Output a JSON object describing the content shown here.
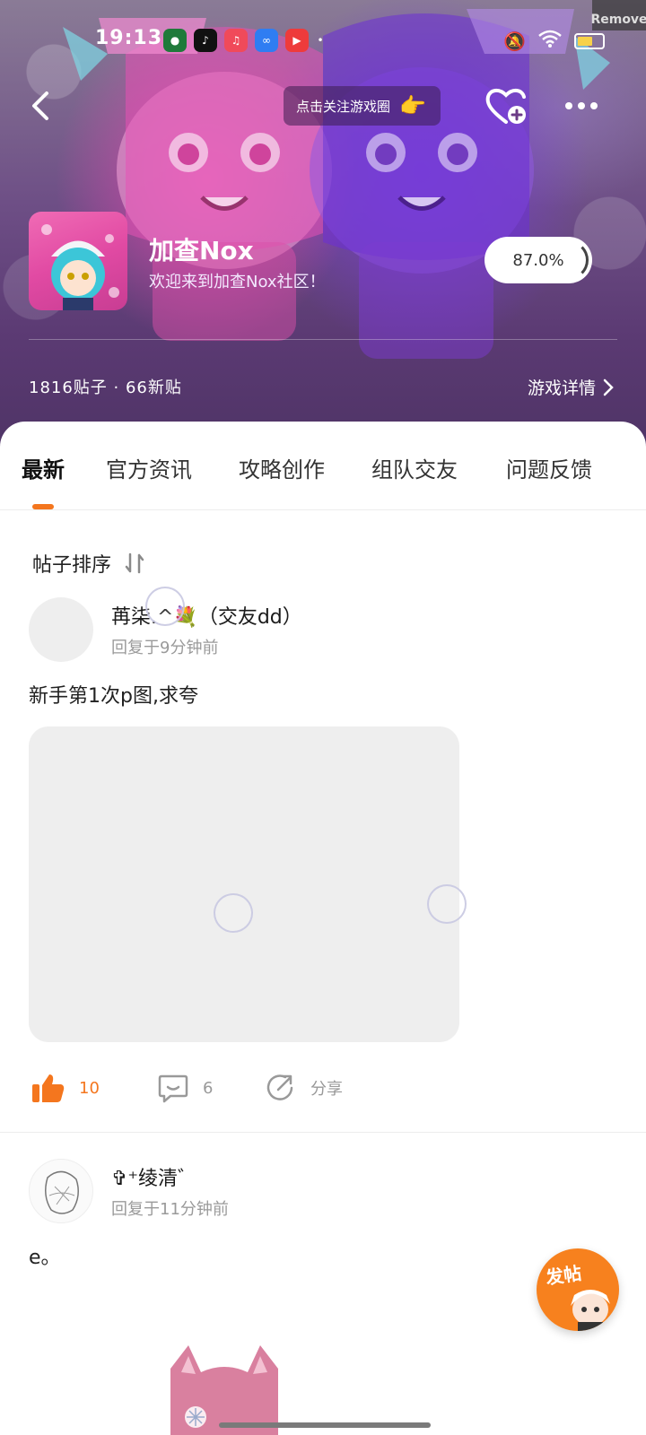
{
  "status_bar": {
    "time": "19:13",
    "remove_label": "Remove"
  },
  "header": {
    "follow_tip": "点击关注游戏圈",
    "follow_tip_icon": "pointing-hand-icon"
  },
  "game": {
    "title": "加查Nox",
    "welcome": "欢迎来到加查Nox社区！",
    "rating": "87.0%",
    "stats": "1816贴子 · 66新贴",
    "detail_link": "游戏详情"
  },
  "tabs": [
    {
      "label": "最新",
      "active": true
    },
    {
      "label": "官方资讯",
      "active": false
    },
    {
      "label": "攻略创作",
      "active": false
    },
    {
      "label": "组队交友",
      "active": false
    },
    {
      "label": "问题反馈",
      "active": false
    }
  ],
  "sort": {
    "label": "帖子排序"
  },
  "posts": [
    {
      "author": "苒柒.^💐（交友dd）",
      "reply_time": "回复于9分钟前",
      "text": "新手第1次p图,求夸",
      "likes": "10",
      "comments": "6",
      "share_label": "分享"
    },
    {
      "author": "✞⁺绫清゛",
      "reply_time": "回复于11分钟前",
      "text": "e。"
    }
  ],
  "fab": {
    "label": "发帖"
  },
  "colors": {
    "accent": "#f4761e",
    "image_placeholder": "#eeeeee"
  }
}
